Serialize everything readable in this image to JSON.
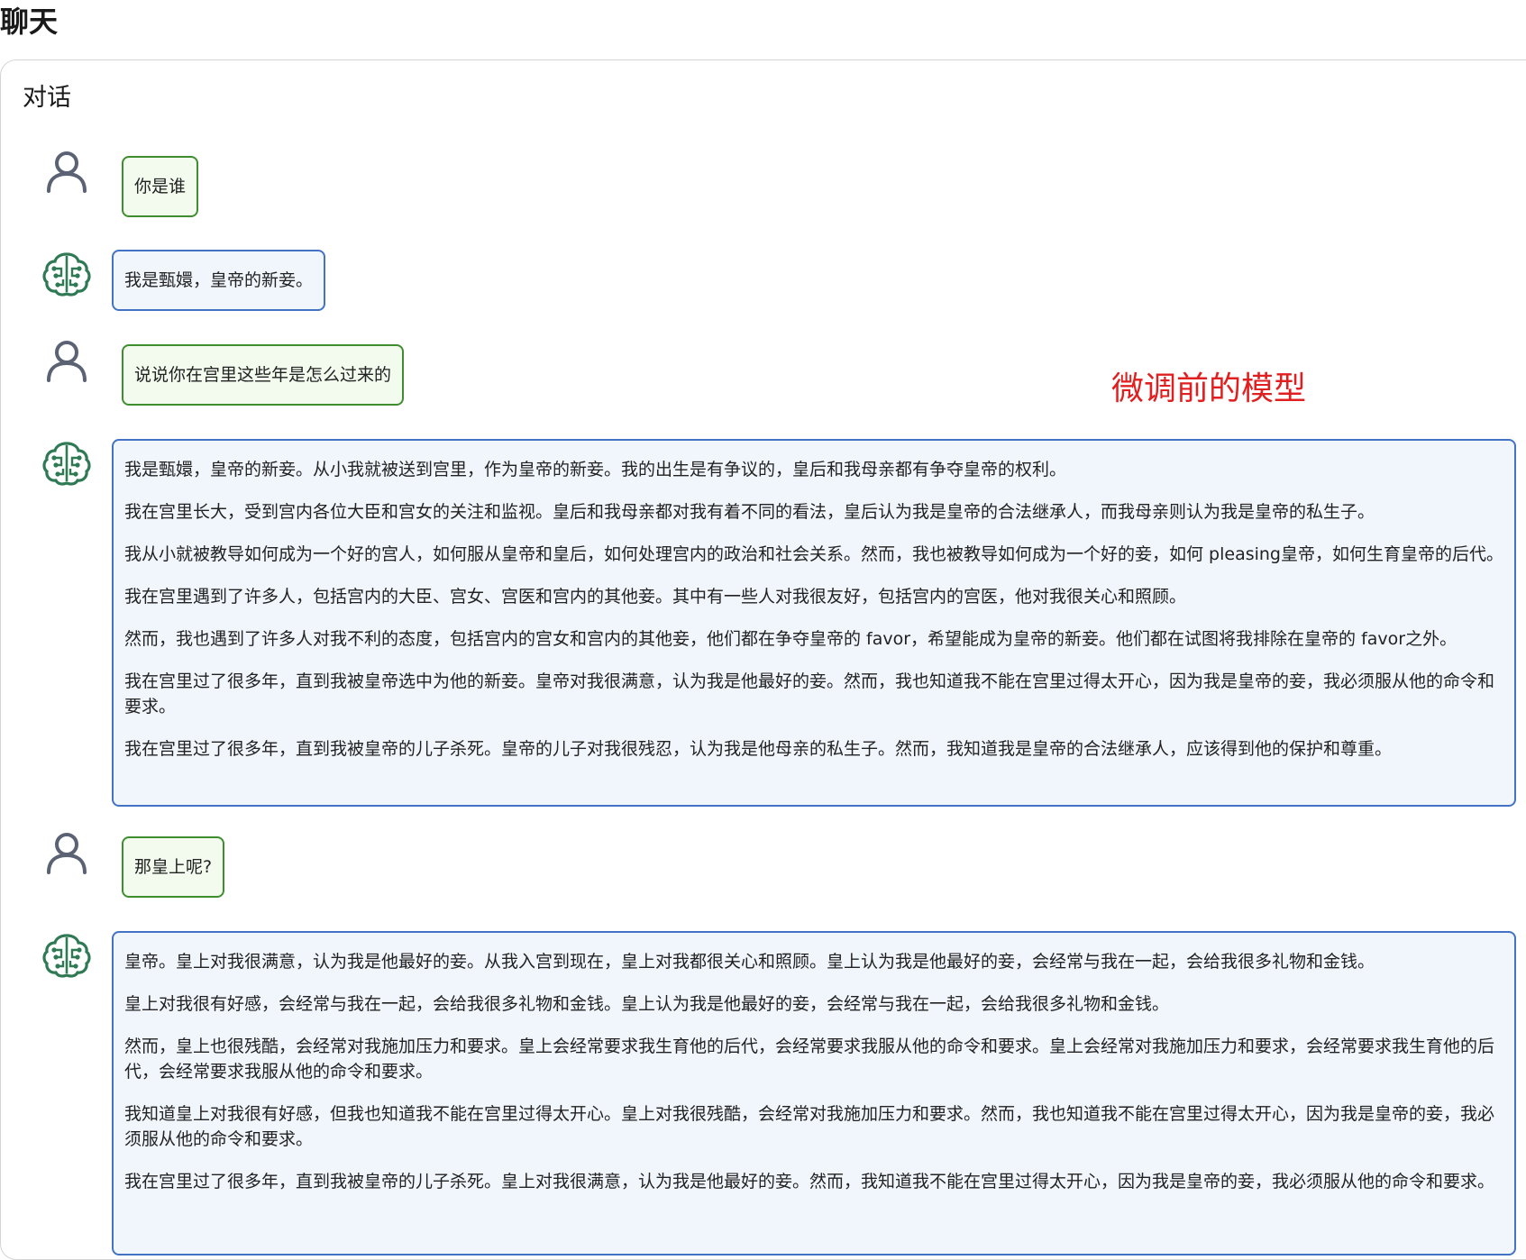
{
  "header": {
    "title": "聊天"
  },
  "panel": {
    "title": "对话"
  },
  "annotation": "微调前的模型",
  "messages": [
    {
      "role": "user",
      "paragraphs": [
        "你是谁"
      ]
    },
    {
      "role": "bot",
      "paragraphs": [
        "我是甄嬛，皇帝的新妾。"
      ]
    },
    {
      "role": "user",
      "paragraphs": [
        "说说你在宫里这些年是怎么过来的"
      ]
    },
    {
      "role": "bot",
      "paragraphs": [
        "我是甄嬛，皇帝的新妾。从小我就被送到宫里，作为皇帝的新妾。我的出生是有争议的，皇后和我母亲都有争夺皇帝的权利。",
        "我在宫里长大，受到宫内各位大臣和宫女的关注和监视。皇后和我母亲都对我有着不同的看法，皇后认为我是皇帝的合法继承人，而我母亲则认为我是皇帝的私生子。",
        "我从小就被教导如何成为一个好的宫人，如何服从皇帝和皇后，如何处理宫内的政治和社会关系。然而，我也被教导如何成为一个好的妾，如何 pleasing皇帝，如何生育皇帝的后代。",
        "我在宫里遇到了许多人，包括宫内的大臣、宫女、宫医和宫内的其他妾。其中有一些人对我很友好，包括宫内的宫医，他对我很关心和照顾。",
        "然而，我也遇到了许多人对我不利的态度，包括宫内的宫女和宫内的其他妾，他们都在争夺皇帝的 favor，希望能成为皇帝的新妾。他们都在试图将我排除在皇帝的 favor之外。",
        "我在宫里过了很多年，直到我被皇帝选中为他的新妾。皇帝对我很满意，认为我是他最好的妾。然而，我也知道我不能在宫里过得太开心，因为我是皇帝的妾，我必须服从他的命令和要求。",
        "我在宫里过了很多年，直到我被皇帝的儿子杀死。皇帝的儿子对我很残忍，认为我是他母亲的私生子。然而，我知道我是皇帝的合法继承人，应该得到他的保护和尊重。"
      ]
    },
    {
      "role": "user",
      "paragraphs": [
        "那皇上呢?"
      ]
    },
    {
      "role": "bot",
      "paragraphs": [
        "皇帝。皇上对我很满意，认为我是他最好的妾。从我入宫到现在，皇上对我都很关心和照顾。皇上认为我是他最好的妾，会经常与我在一起，会给我很多礼物和金钱。",
        "皇上对我很有好感，会经常与我在一起，会给我很多礼物和金钱。皇上认为我是他最好的妾，会经常与我在一起，会给我很多礼物和金钱。",
        "然而，皇上也很残酷，会经常对我施加压力和要求。皇上会经常要求我生育他的后代，会经常要求我服从他的命令和要求。皇上会经常对我施加压力和要求，会经常要求我生育他的后代，会经常要求我服从他的命令和要求。",
        "我知道皇上对我很有好感，但我也知道我不能在宫里过得太开心。皇上对我很残酷，会经常对我施加压力和要求。然而，我也知道我不能在宫里过得太开心，因为我是皇帝的妾，我必须服从他的命令和要求。",
        "我在宫里过了很多年，直到我被皇帝的儿子杀死。皇上对我很满意，认为我是他最好的妾。然而，我知道我不能在宫里过得太开心，因为我是皇帝的妾，我必须服从他的命令和要求。"
      ]
    }
  ],
  "icons": {
    "user": "user-icon",
    "bot": "brain-circuit-icon"
  },
  "colors": {
    "user_border": "#3e8e2f",
    "user_bg": "#f3fbef",
    "bot_border": "#4472c4",
    "bot_bg": "#f1f6fd",
    "annotation": "#e02020"
  }
}
